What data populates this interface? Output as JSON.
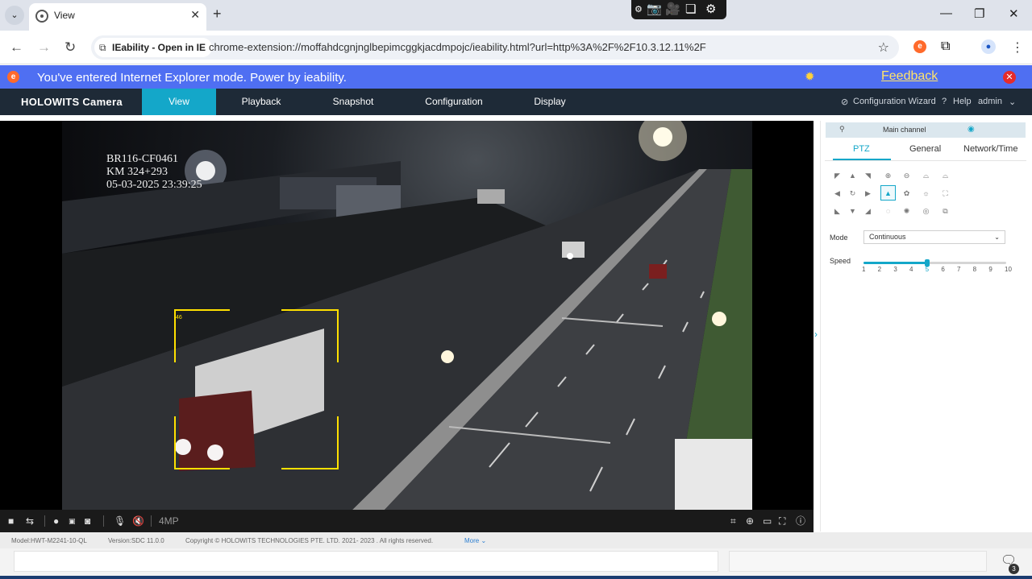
{
  "browser": {
    "tab_title": "View",
    "tab_close": "✕",
    "new_tab": "+",
    "tab_menu": "⌄",
    "window_controls": {
      "minimize": "—",
      "restore": "❐",
      "close": "✕"
    },
    "nav": {
      "back": "←",
      "forward": "→",
      "reload": "↻"
    },
    "site_chip": "IEability - Open in IE",
    "url": "chrome-extension://moffahdcgnjnglbepimcggkjacdmpojc/ieability.html?url=http%3A%2F%2F10.3.12.11%2F",
    "star": "☆"
  },
  "capture_bar": {
    "icons": [
      "ops-icon",
      "camera-icon",
      "video-icon",
      "copy-icon",
      "settings-icon"
    ]
  },
  "ie_banner": {
    "message": "You've entered Internet Explorer mode. Power by ieability.",
    "feedback": "Feedback",
    "logo": "e",
    "close": "✕"
  },
  "app": {
    "brand": "HOLOWITS Camera",
    "tabs": [
      {
        "label": "View",
        "active": true
      },
      {
        "label": "Playback",
        "active": false
      },
      {
        "label": "Snapshot",
        "active": false
      },
      {
        "label": "Configuration",
        "active": false
      },
      {
        "label": "Display",
        "active": false
      }
    ],
    "config_wizard": "Configuration Wizard",
    "help": "Help",
    "user": "admin"
  },
  "video": {
    "osd_line1": "BR116-CF0461",
    "osd_line2": "KM 324+293",
    "osd_line3": "05-03-2025 23:39:25",
    "detection_label": "46",
    "resolution": "4MP"
  },
  "panel": {
    "channel": "Main channel",
    "tabs": [
      {
        "label": "PTZ",
        "active": true
      },
      {
        "label": "General",
        "active": false
      },
      {
        "label": "Network/Time",
        "active": false
      }
    ],
    "mode_label": "Mode",
    "mode_value": "Continuous",
    "speed_label": "Speed",
    "speed_value": 5,
    "speed_ticks": [
      "1",
      "2",
      "3",
      "4",
      "5",
      "6",
      "7",
      "8",
      "9",
      "10"
    ]
  },
  "footer": {
    "model": "Model:HWT-M2241-10-QL",
    "version": "Version:SDC 11.0.0",
    "copyright": "Copyright © HOLOWITS TECHNOLOGIES PTE. LTD. 2021- 2023 . All rights reserved.",
    "more": "More ⌄"
  },
  "notification_count": "3",
  "colors": {
    "accent": "#14a7c9",
    "banner": "#4f6ff2",
    "nav_bg": "#1e2a37",
    "osd_box": "#ffe000"
  }
}
